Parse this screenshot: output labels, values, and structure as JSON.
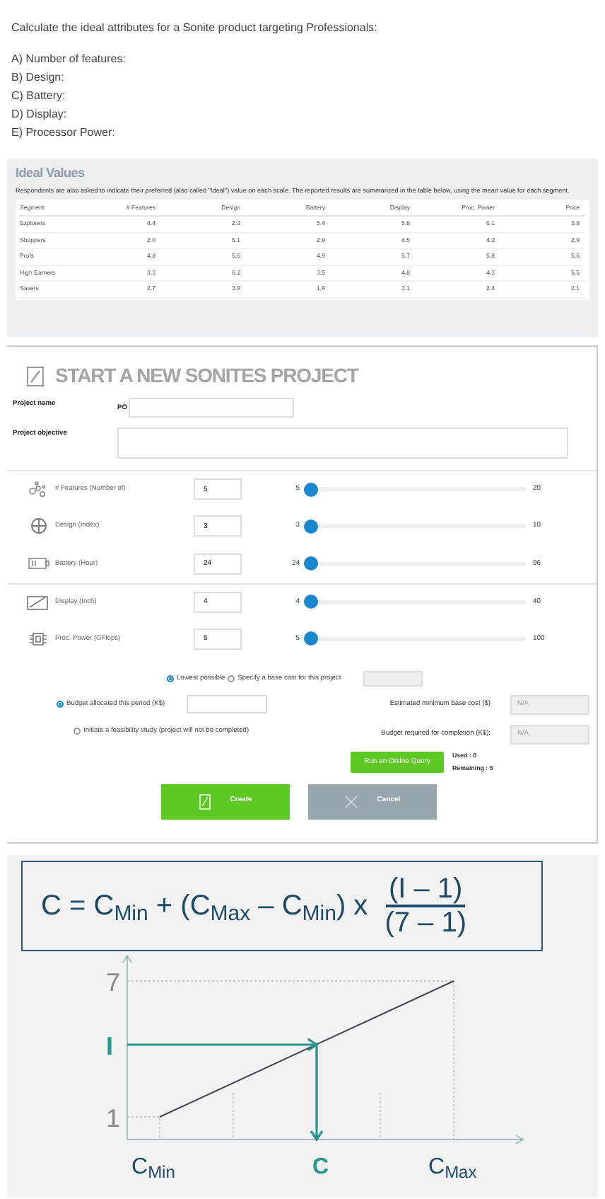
{
  "question": {
    "prompt": "Calculate the ideal attributes for a Sonite product targeting Professionals:",
    "items": [
      "A) Number of features:",
      "B) Design:",
      "C) Battery:",
      "D) Display:",
      "E) Processor Power:"
    ]
  },
  "ideal_values": {
    "title": "Ideal Values",
    "description": "Respondents are also asked to indicate their preferred (also called \"Ideal\") value on each scale. The reported results are summarized in the table below, using the mean value for each segment.",
    "columns": [
      "Segment",
      "# Features",
      "Design",
      "Battery",
      "Display",
      "Proc. Power",
      "Price"
    ],
    "rows": [
      [
        "Explorers",
        "4.4",
        "2.3",
        "5.4",
        "5.8",
        "6.1",
        "3.8"
      ],
      [
        "Shoppers",
        "2.0",
        "5.1",
        "2.9",
        "4.5",
        "4.2",
        "2.9"
      ],
      [
        "Profs",
        "4.8",
        "5.6",
        "4.9",
        "5.7",
        "5.8",
        "5.6"
      ],
      [
        "High Earners",
        "3.3",
        "6.2",
        "3.5",
        "4.8",
        "4.3",
        "5.5"
      ],
      [
        "Savers",
        "2.7",
        "3.9",
        "1.9",
        "3.1",
        "2.4",
        "2.1"
      ]
    ]
  },
  "project": {
    "title": "START A NEW SONITES PROJECT",
    "name_label": "Project name",
    "name_prefix": "PO",
    "objective_label": "Project objective",
    "attributes": [
      {
        "kind": "features",
        "label": "# Features (Number of)",
        "value": "5",
        "min": "5",
        "max": "20",
        "level": 0
      },
      {
        "kind": "design",
        "label": "Design (Index)",
        "value": "3",
        "min": "3",
        "max": "10",
        "level": 0
      },
      {
        "kind": "battery",
        "label": "Battery (Hour)",
        "value": "24",
        "min": "24",
        "max": "96",
        "level": 0
      },
      {
        "kind": "display",
        "label": "Display (Inch)",
        "value": "4",
        "min": "4",
        "max": "40",
        "level": 0
      },
      {
        "kind": "power",
        "label": "Proc. Power (GFlops)",
        "value": "5",
        "min": "5",
        "max": "100",
        "level": 0
      }
    ],
    "cost_options": [
      {
        "label": "Lowest possible",
        "selected": true
      },
      {
        "label": "Specify a base cost for this project",
        "selected": false
      }
    ],
    "budget_options": [
      {
        "label": "Budget allocated this period (K$)",
        "selected": true
      },
      {
        "label": "Initiate a feasibility study (project will not be completed)",
        "selected": false
      }
    ],
    "estimates": [
      {
        "label": "Estimated minimum base cost ($)",
        "value": "N/A"
      },
      {
        "label": "Budget required for completion (K$):",
        "value": "N/A"
      }
    ],
    "query_button": "Run an Online Query",
    "used": "Used : 0",
    "remaining": "Remaining : 5",
    "create_button": "Create",
    "cancel_button": "Cancel"
  },
  "formula": {
    "lhs": "C = C$_{Min}$ + (C$_{Max}$ – C$_{Min}$) x",
    "numerator": "(I – 1)",
    "denominator": "(7 – 1)",
    "y_labels": [
      {
        "text": "7",
        "kind": "plain"
      },
      {
        "text": "I",
        "kind": "accent"
      },
      {
        "text": "1",
        "kind": "plain"
      }
    ],
    "x_labels": [
      {
        "base": "C",
        "sub": "Min",
        "kind": "plain"
      },
      {
        "base": "C",
        "kind": "accent"
      },
      {
        "base": "C",
        "sub": "Max",
        "kind": "plain"
      }
    ]
  }
}
